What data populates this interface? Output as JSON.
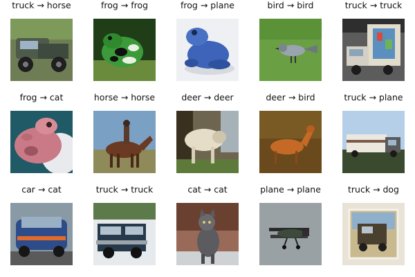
{
  "images": [
    {
      "caption": "truck → horse",
      "subject": "pickup-truck"
    },
    {
      "caption": "frog → frog",
      "subject": "green-spotted-frog"
    },
    {
      "caption": "frog → plane",
      "subject": "blue-frog"
    },
    {
      "caption": "bird → bird",
      "subject": "small-bird-on-grass"
    },
    {
      "caption": "truck → truck",
      "subject": "box-truck"
    },
    {
      "caption": "frog → cat",
      "subject": "pink-frog"
    },
    {
      "caption": "horse → horse",
      "subject": "horse-with-rider"
    },
    {
      "caption": "deer → deer",
      "subject": "white-animal"
    },
    {
      "caption": "deer → bird",
      "subject": "orange-deer"
    },
    {
      "caption": "truck → plane",
      "subject": "white-truck"
    },
    {
      "caption": "car → cat",
      "subject": "blue-car"
    },
    {
      "caption": "truck → truck",
      "subject": "dark-truck"
    },
    {
      "caption": "cat → cat",
      "subject": "grey-cat"
    },
    {
      "caption": "plane → plane",
      "subject": "biplane"
    },
    {
      "caption": "truck → dog",
      "subject": "truck-in-frame"
    }
  ]
}
